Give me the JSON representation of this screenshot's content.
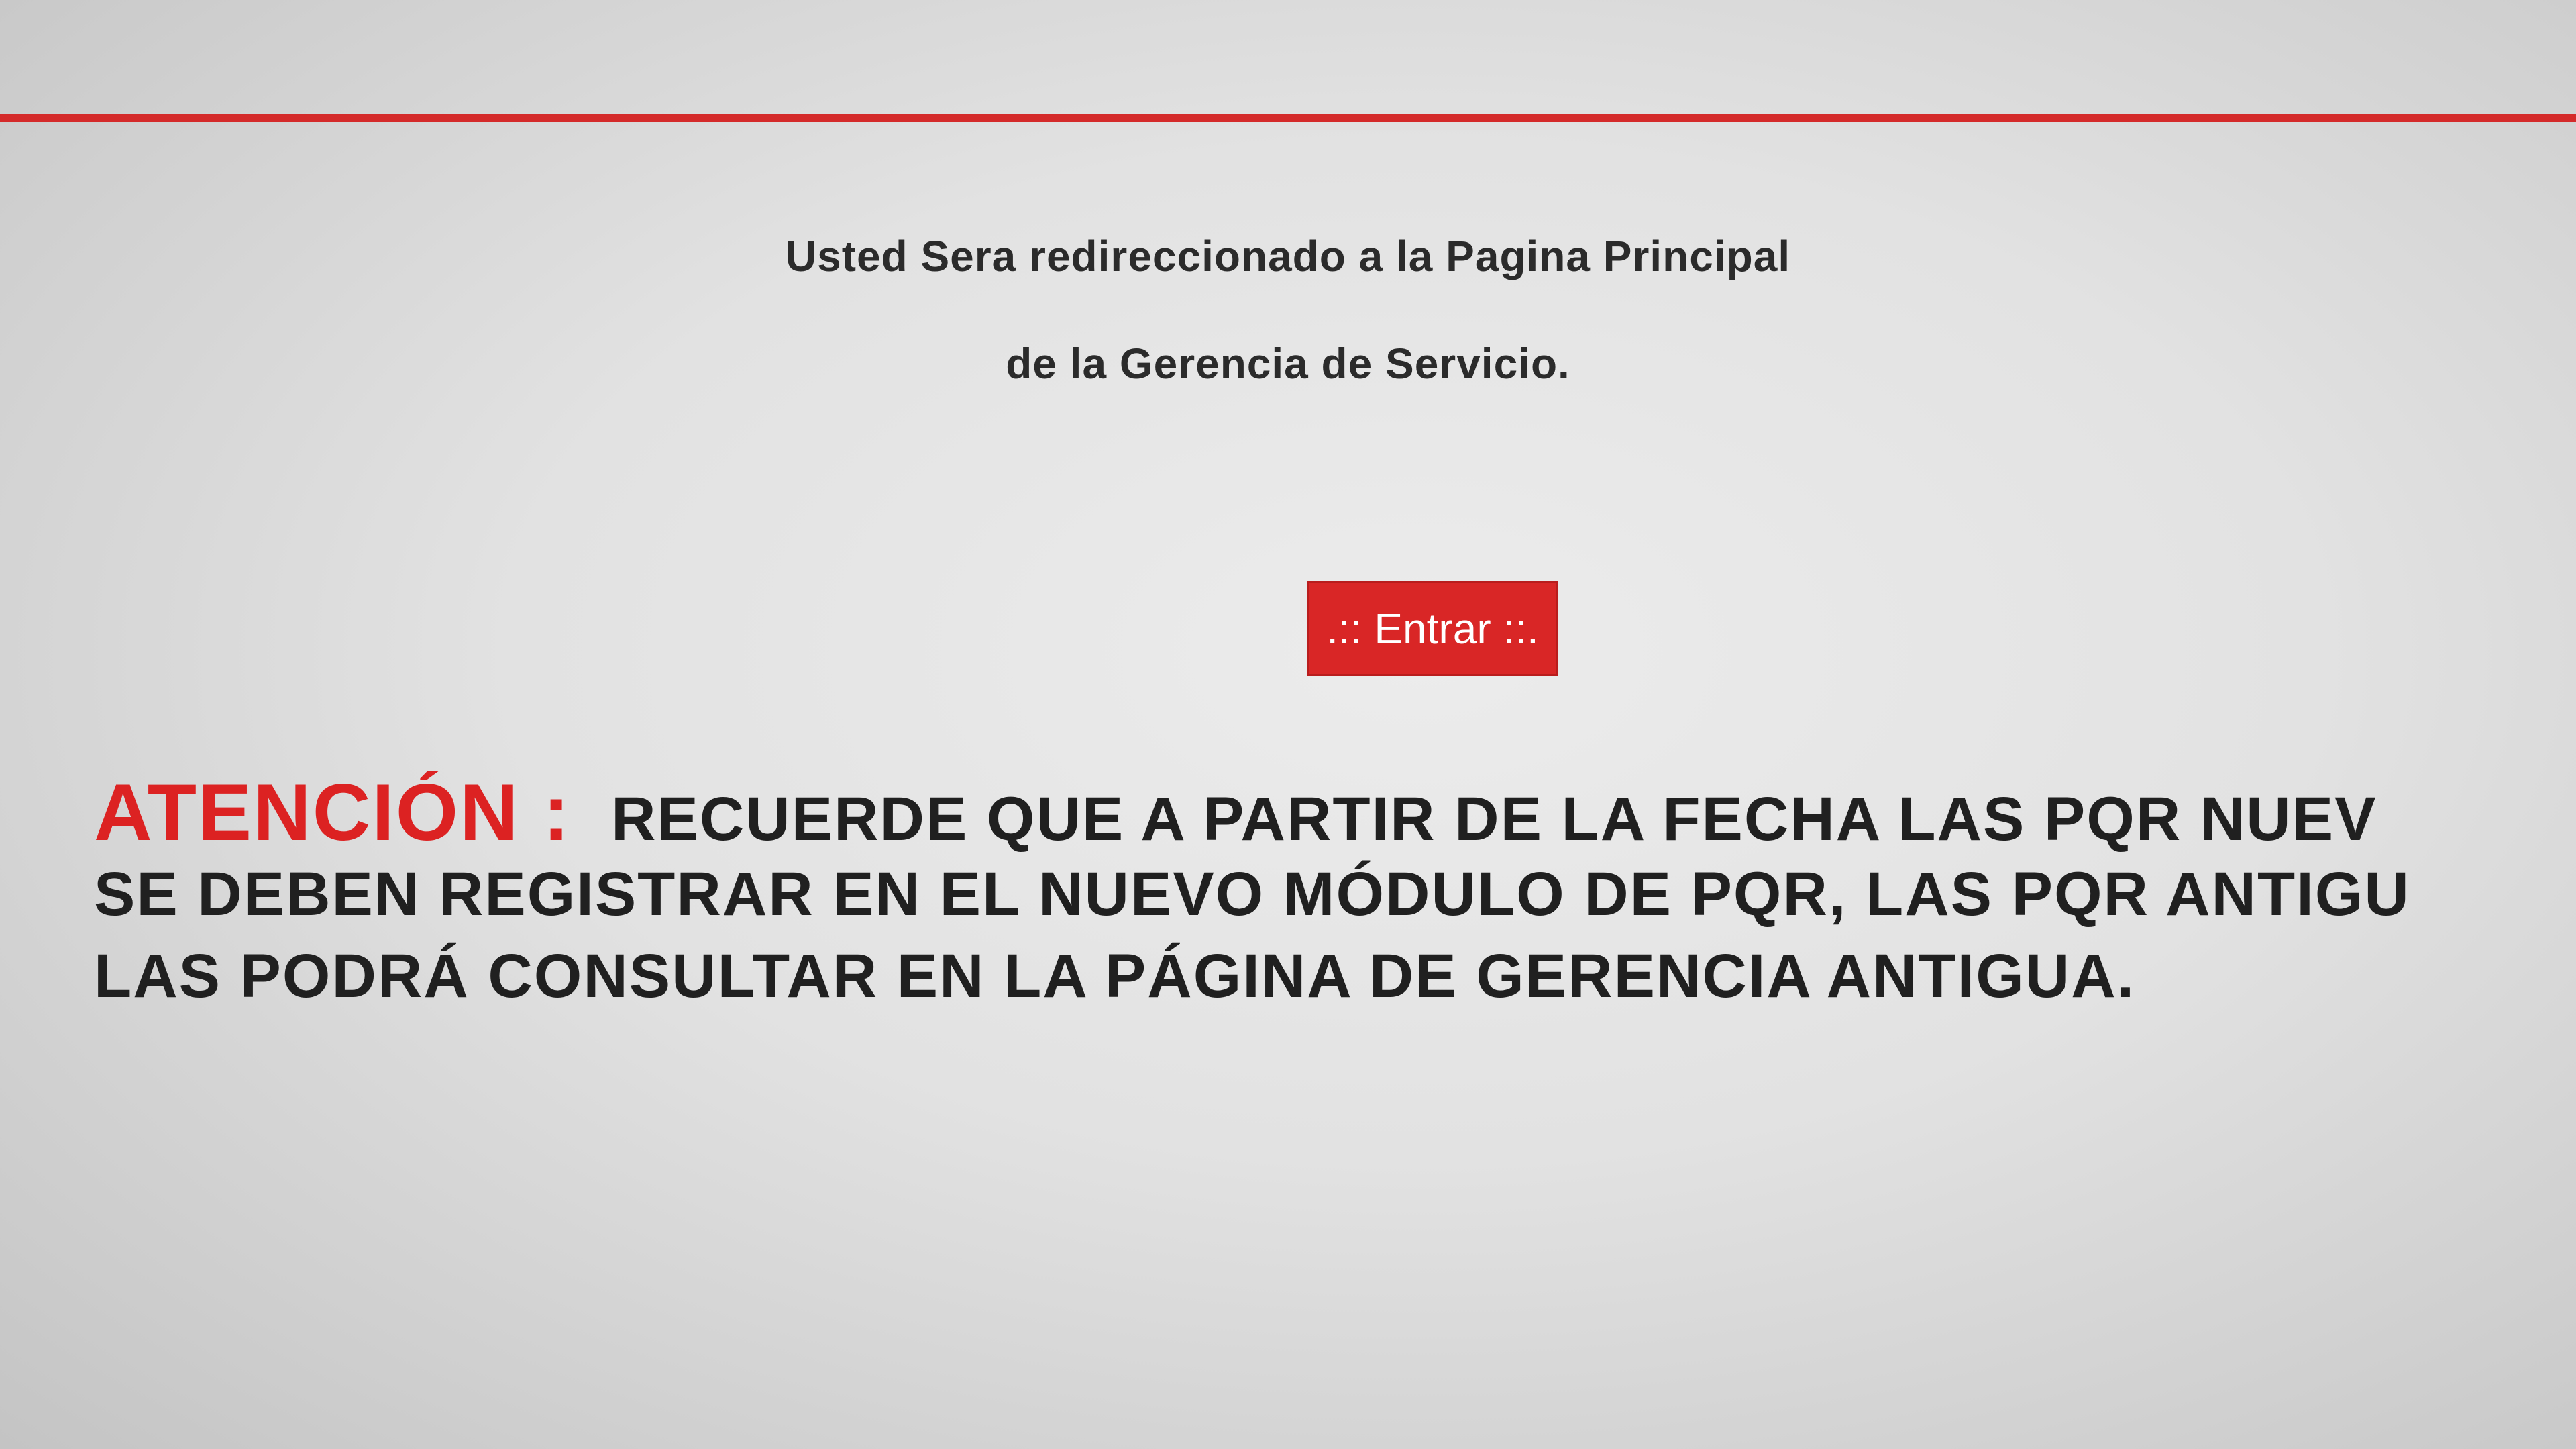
{
  "redirect": {
    "line1": "Usted Sera redireccionado a la Pagina Principal",
    "line2": "de la Gerencia de Servicio."
  },
  "enter_button": {
    "label": ".:: Entrar ::."
  },
  "notice": {
    "label": "ATENCIÓN :",
    "line1": "RECUERDE QUE A PARTIR DE LA FECHA LAS PQR NUEV",
    "line2": "SE DEBEN REGISTRAR EN EL NUEVO MÓDULO DE PQR, LAS PQR ANTIGU",
    "line3": "LAS PODRÁ CONSULTAR EN LA PÁGINA DE GERENCIA ANTIGUA."
  },
  "colors": {
    "accent": "#d92626",
    "text": "#202020",
    "background": "#e2e2e2"
  }
}
